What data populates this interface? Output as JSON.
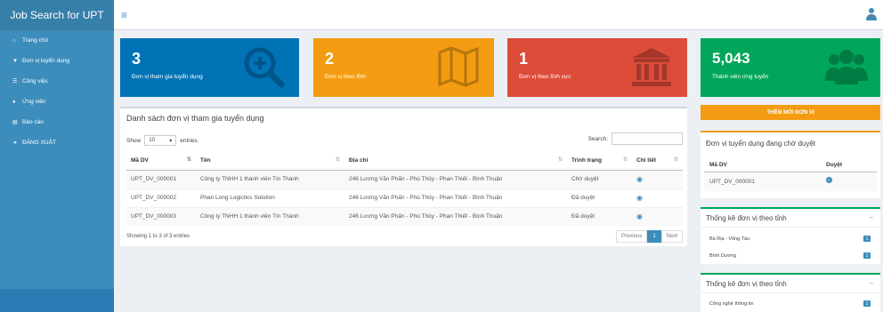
{
  "app": {
    "title": "Job Search for UPT"
  },
  "sidebar": {
    "items": [
      {
        "icon": "home-icon",
        "label": "Trang chủ"
      },
      {
        "icon": "filter-icon",
        "label": "Đơn vị tuyển dụng"
      },
      {
        "icon": "list-icon",
        "label": "Công việc"
      },
      {
        "icon": "users-icon",
        "label": "Ứng viên"
      },
      {
        "icon": "report-icon",
        "label": "Báo cáo"
      },
      {
        "icon": "logout-icon",
        "label": "ĐĂNG XUẤT"
      }
    ]
  },
  "info_boxes": [
    {
      "value": "3",
      "label": "Đơn vị tham gia tuyển dụng",
      "color": "#0073b7",
      "icon": "search-plus-icon"
    },
    {
      "value": "2",
      "label": "Đơn vị theo tỉnh",
      "color": "#f39c12",
      "icon": "map-icon"
    },
    {
      "value": "1",
      "label": "Đơn vị theo lĩnh vực",
      "color": "#dd4b39",
      "icon": "bank-icon"
    },
    {
      "value": "5,043",
      "label": "Thành viên ứng tuyển",
      "color": "#00a65a",
      "icon": "users-icon"
    }
  ],
  "main": {
    "title": "Danh sách đơn vị tham gia tuyển dụng",
    "show_label": "Show",
    "page_size": "10",
    "entries_label": "entries",
    "search_label": "Search:",
    "columns": [
      "Mã DV",
      "Tên",
      "Địa chỉ",
      "Trình trạng",
      "Chi tiết"
    ],
    "rows": [
      {
        "id": "UPT_DV_000001",
        "name": "Công ty TNHH 1 thành viên Tín Thành",
        "address": "246 Lương Văn Phấn - Phú Thủy - Phan Thiết - Bình Thuận",
        "status": "Chờ duyệt"
      },
      {
        "id": "UPT_DV_000002",
        "name": "Phan Long Logictics Solution",
        "address": "246 Lương Văn Phấn - Phú Thủy - Phan Thiết - Bình Thuận",
        "status": "Đã duyệt"
      },
      {
        "id": "UPT_DV_000003",
        "name": "Công ty TNHH 1 thành viên Tín Thành",
        "address": "246 Lương Văn Phấn - Phú Thủy - Phan Thiết - Bình Thuận",
        "status": "Đã duyệt"
      }
    ],
    "showing": "Showing 1 to 3 of 3 entries",
    "pager": {
      "previous": "Previous",
      "current": "1",
      "next": "Next"
    }
  },
  "right": {
    "add_button": "THÊM MỚI ĐƠN VỊ",
    "pending": {
      "title": "Đơn vị tuyển dụng đang chờ duyệt",
      "col_id": "Mã DV",
      "col_approve": "Duyệt",
      "row_id": "UPT_DV_000001"
    },
    "stat1": {
      "title": "Thống kê đơn vị theo tỉnh",
      "items": [
        {
          "label": "Bà Rịa - Vũng Tàu",
          "count": "1"
        },
        {
          "label": "Bình Dương",
          "count": "1"
        }
      ]
    },
    "stat2": {
      "title": "Thống kê đơn vị theo tỉnh",
      "items": [
        {
          "label": "Công nghệ thông tin",
          "count": "1"
        }
      ]
    }
  }
}
